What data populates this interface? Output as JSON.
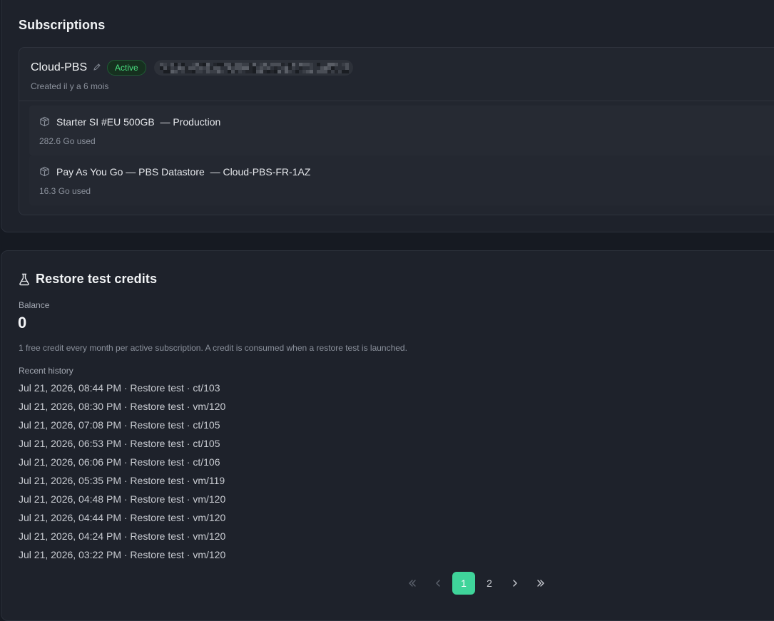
{
  "subscriptions": {
    "title": "Subscriptions",
    "subscription": {
      "name": "Cloud-PBS",
      "status": "Active",
      "created": "Created il y a 6 mois",
      "items": [
        {
          "title": "Starter SI #EU 500GB  — Production",
          "usage": "282.6 Go used",
          "icon": "package-icon"
        },
        {
          "title": "Pay As You Go — PBS Datastore  — Cloud-PBS-FR-1AZ",
          "usage": "16.3 Go used",
          "icon": "package-icon"
        }
      ]
    }
  },
  "credits": {
    "title": "Restore test credits",
    "icon": "flask-icon",
    "balance_label": "Balance",
    "balance_value": "0",
    "note": "1 free credit every month per active subscription. A credit is consumed when a restore test is launched.",
    "history_label": "Recent history",
    "history": [
      "Jul 21, 2026, 08:44 PM · Restore test · ct/103",
      "Jul 21, 2026, 08:30 PM · Restore test · vm/120",
      "Jul 21, 2026, 07:08 PM · Restore test · ct/105",
      "Jul 21, 2026, 06:53 PM · Restore test · ct/105",
      "Jul 21, 2026, 06:06 PM · Restore test · ct/106",
      "Jul 21, 2026, 05:35 PM · Restore test · vm/119",
      "Jul 21, 2026, 04:48 PM · Restore test · vm/120",
      "Jul 21, 2026, 04:44 PM · Restore test · vm/120",
      "Jul 21, 2026, 04:24 PM · Restore test · vm/120",
      "Jul 21, 2026, 03:22 PM · Restore test · vm/120"
    ]
  },
  "pagination": {
    "pages": [
      "1",
      "2"
    ],
    "current_page": "1"
  },
  "colors": {
    "accent": "#3fd49a",
    "status_active": "#4ade80",
    "background": "#161a22",
    "card": "#1e222b"
  }
}
